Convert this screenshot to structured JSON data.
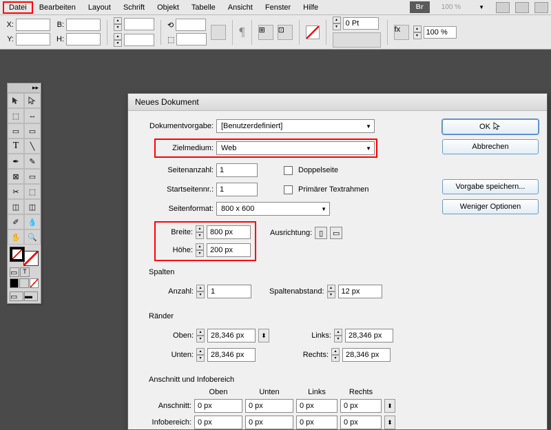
{
  "menu": {
    "items": [
      "Datei",
      "Bearbeiten",
      "Layout",
      "Schrift",
      "Objekt",
      "Tabelle",
      "Ansicht",
      "Fenster",
      "Hilfe"
    ],
    "br": "Br",
    "zoom": "100 %"
  },
  "toolbar": {
    "x": "X:",
    "y": "Y:",
    "b": "B:",
    "h": "H:",
    "stroke_val": "0 Pt",
    "pct": "100 %"
  },
  "dialog": {
    "title": "Neues Dokument",
    "preset_label": "Dokumentvorgabe:",
    "preset_value": "[Benutzerdefiniert]",
    "intent_label": "Zielmedium:",
    "intent_value": "Web",
    "pages_label": "Seitenanzahl:",
    "pages_value": "1",
    "facing_label": "Doppelseite",
    "startpage_label": "Startseitennr.:",
    "startpage_value": "1",
    "textframe_label": "Primärer Textrahmen",
    "pagesize_label": "Seitenformat:",
    "pagesize_value": "800 x 600",
    "width_label": "Breite:",
    "width_value": "800 px",
    "height_label": "Höhe:",
    "height_value": "200 px",
    "orientation_label": "Ausrichtung:",
    "cols_section": "Spalten",
    "cols_count_label": "Anzahl:",
    "cols_count_value": "1",
    "cols_gutter_label": "Spaltenabstand:",
    "cols_gutter_value": "12 px",
    "margins_section": "Ränder",
    "top_label": "Oben:",
    "bottom_label": "Unten:",
    "left_label": "Links:",
    "right_label": "Rechts:",
    "margin_value": "28,346 px",
    "bleed_section": "Anschnitt und Infobereich",
    "col_top": "Oben",
    "col_bottom": "Unten",
    "col_left": "Links",
    "col_right": "Rechts",
    "bleed_label": "Anschnitt:",
    "slug_label": "Infobereich:",
    "zero": "0 px",
    "ok": "OK",
    "cancel": "Abbrechen",
    "save_preset": "Vorgabe speichern...",
    "fewer": "Weniger Optionen"
  }
}
